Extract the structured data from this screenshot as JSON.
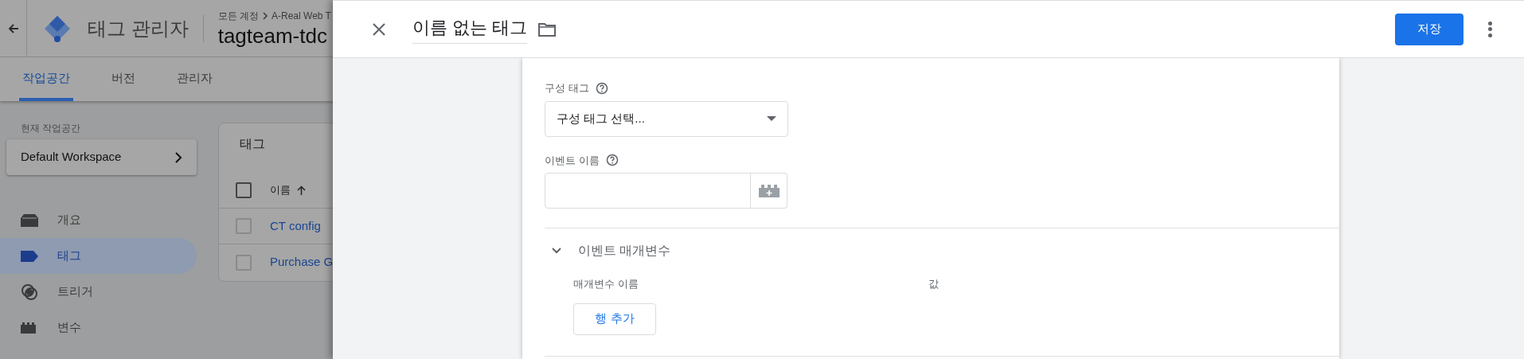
{
  "app_header": {
    "title": "태그 관리자",
    "breadcrumb": [
      "모든 계정",
      "A-Real Web T"
    ],
    "container_name": "tagteam-tdc"
  },
  "nav_tabs": [
    {
      "label": "작업공간",
      "selected": true
    },
    {
      "label": "버전",
      "selected": false
    },
    {
      "label": "관리자",
      "selected": false
    }
  ],
  "workspace": {
    "label": "현재 작업공간",
    "name": "Default Workspace"
  },
  "sidebar": {
    "items": [
      {
        "kind": "overview",
        "label": "개요",
        "selected": false
      },
      {
        "kind": "tag",
        "label": "태그",
        "selected": true
      },
      {
        "kind": "trigger",
        "label": "트리거",
        "selected": false
      },
      {
        "kind": "variable",
        "label": "변수",
        "selected": false
      }
    ]
  },
  "tags_table": {
    "title": "태그",
    "select_all_checked": false,
    "column": {
      "label": "이름",
      "sorted_ascending": true
    },
    "rows": [
      {
        "name": "CT config",
        "checked": false
      },
      {
        "name": "Purchase G",
        "checked": false
      }
    ]
  },
  "editor": {
    "title": "이름 없는 태그",
    "save_label": "저장",
    "fields": [
      {
        "kind": "select",
        "label": "구성 태그",
        "value": "구성 태그 선택..."
      },
      {
        "kind": "variable_input",
        "label": "이벤트 이름"
      }
    ],
    "section": {
      "title": "이벤트 매개변수",
      "expanded": true,
      "columns": [
        "매개변수 이름",
        "값"
      ],
      "add_row_label": "행 추가"
    }
  }
}
